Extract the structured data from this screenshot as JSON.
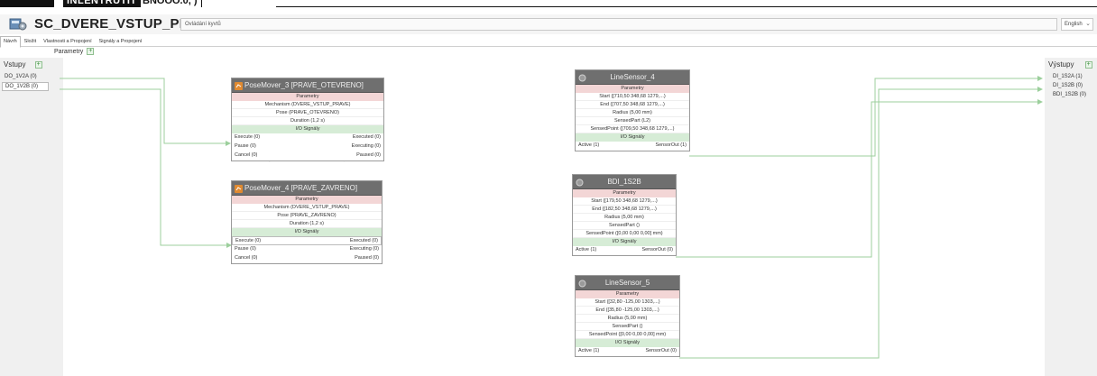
{
  "top_banner": {
    "tag": "INLENTRUTIT",
    "tag2": "BNOOO.0, )"
  },
  "header": {
    "title": "SC_DVERE_VSTUP_PR...",
    "breadcrumb": "Ovládání kyvtů",
    "language": "English"
  },
  "tabs": [
    {
      "label": "Návrh"
    },
    {
      "label": "Složit"
    },
    {
      "label": "Vlastnosti a Propojení"
    },
    {
      "label": "Signály a Propojení"
    }
  ],
  "parameters_label": "Parametry",
  "inputs": {
    "title": "Vstupy",
    "items": [
      "DO_1V2A (0)",
      "DO_1V2B (0)"
    ]
  },
  "outputs": {
    "title": "Výstupy",
    "items": [
      "DI_1S2A (1)",
      "DI_1S2B (0)",
      "BDI_1S2B (0)"
    ]
  },
  "blocks": {
    "pm3": {
      "title": "PoseMover_3 [PRAVE_OTEVRENO]",
      "params_label": "Parametry",
      "params": [
        "Mechanism (DVERE_VSTUP_PRAVE)",
        "Pose (PRAVE_OTEVRENO)",
        "Duration (1,2 s)"
      ],
      "io_label": "I/O Signály",
      "signals": [
        {
          "in": "Execute (0)",
          "out": "Executed (0)"
        },
        {
          "in": "Pause (0)",
          "out": "Executing (0)"
        },
        {
          "in": "Cancel (0)",
          "out": "Paused (0)"
        }
      ]
    },
    "pm4": {
      "title": "PoseMover_4 [PRAVE_ZAVRENO]",
      "params_label": "Parametry",
      "params": [
        "Mechanism (DVERE_VSTUP_PRAVE)",
        "Pose (PRAVE_ZAVRENO)",
        "Duration (1,2 s)"
      ],
      "io_label": "I/O Signály",
      "signals": [
        {
          "in": "Execute (0)",
          "out": "Executed (0)"
        },
        {
          "in": "Pause (0)",
          "out": "Executing (0)"
        },
        {
          "in": "Cancel (0)",
          "out": "Paused (0)"
        }
      ]
    },
    "ls4": {
      "title": "LineSensor_4",
      "params_label": "Parametry",
      "params": [
        "Start ([710,50 348,68 1279,...)",
        "End ([707,50 348,68 1279,...)",
        "Radius (5,00 mm)",
        "SensedPart (L2)",
        "SensedPoint ([709,50 348,68 1279,...)"
      ],
      "io_label": "I/O Signály",
      "signal": {
        "in": "Active (1)",
        "out": "SensorOut (1)"
      }
    },
    "bdi": {
      "title": "BDI_1S2B",
      "params_label": "Parametry",
      "params": [
        "Start ([179,50 348,68 1279,...)",
        "End ([182,50 348,68 1279,...)",
        "Radius (5,00 mm)",
        "SensedPart ()",
        "SensedPoint ([0,00 0,00 0,00] mm)"
      ],
      "io_label": "I/O Signály",
      "signal": {
        "in": "Active (1)",
        "out": "SensorOut (0)"
      }
    },
    "ls5": {
      "title": "LineSensor_5",
      "params_label": "Parametry",
      "params": [
        "Start ([32,80 -125,00 1303,...)",
        "End ([35,80 -125,00 1303,...)",
        "Radius (5,00 mm)",
        "SensedPart ()",
        "SensedPoint ([0,00 0,00 0,00] mm)"
      ],
      "io_label": "I/O Signály",
      "signal": {
        "in": "Active (1)",
        "out": "SensorOut (0)"
      }
    }
  },
  "colors": {
    "wire": "#9ccf9c",
    "internal_wire": "#b0b0b0",
    "block_header": "#6f6f6f",
    "params_section": "#f3d6d6",
    "io_section": "#d6ecd6"
  }
}
